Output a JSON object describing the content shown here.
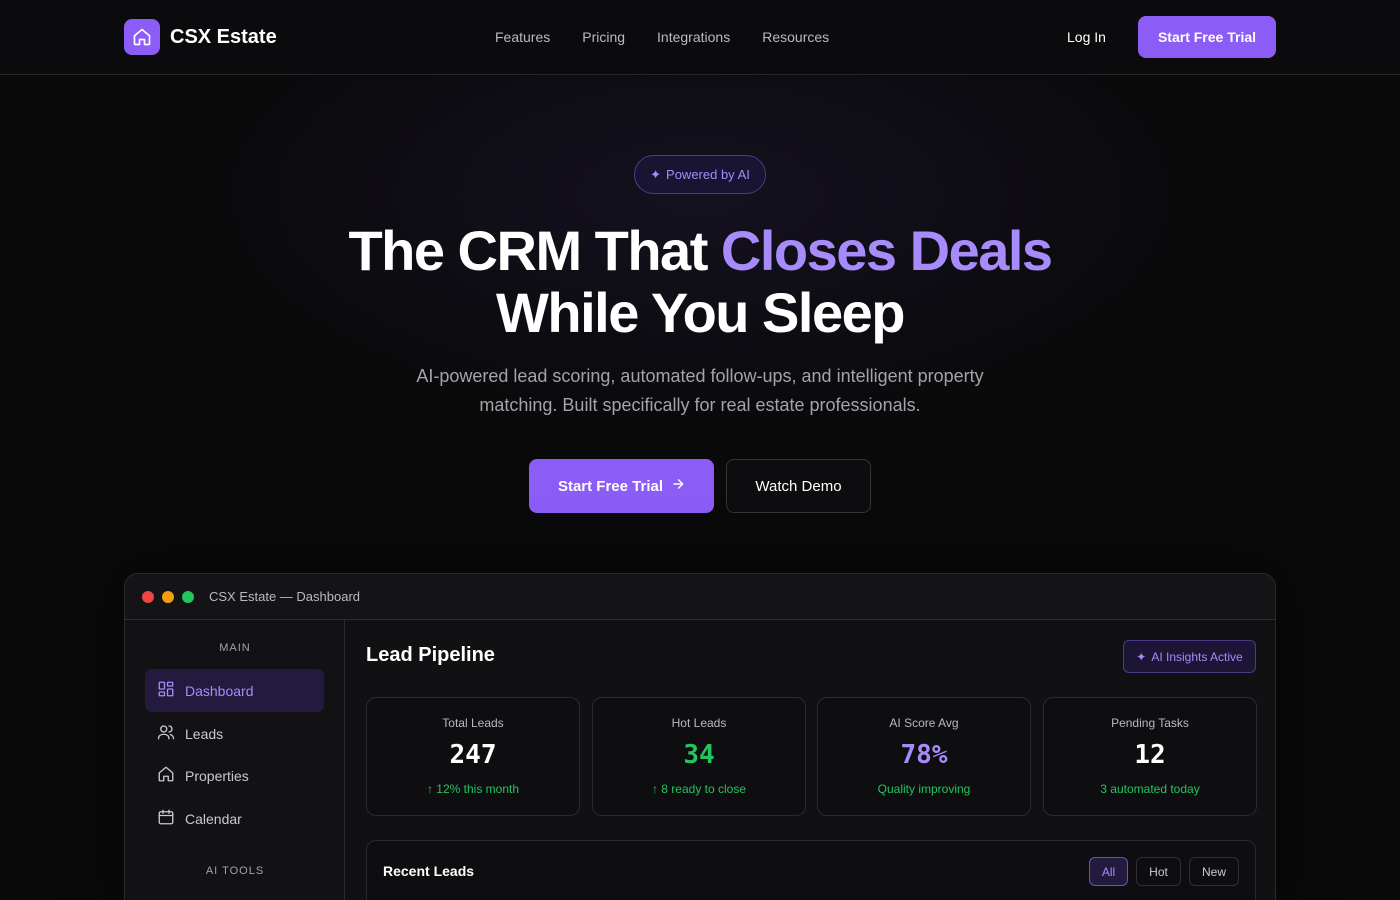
{
  "brand": {
    "name": "CSX Estate",
    "accent": "#8b5cf6",
    "logo_icon": "house-icon"
  },
  "nav": {
    "links": [
      "Features",
      "Pricing",
      "Integrations",
      "Resources"
    ],
    "login": "Log In",
    "cta": "Start Free Trial"
  },
  "hero": {
    "badge": "Powered by AI",
    "badge_icon": "sparkle-icon",
    "headline_part1": "The CRM That ",
    "headline_accent": "Closes Deals",
    "headline_line2": "While You Sleep",
    "subheading": "AI-powered lead scoring, automated follow-ups, and intelligent property matching. Built specifically for real estate professionals.",
    "primary_cta": "Start Free Trial",
    "secondary_cta": "Watch Demo"
  },
  "dashboard": {
    "window_title": "CSX Estate — Dashboard",
    "sidebar": {
      "main_heading": "MAIN",
      "items": [
        {
          "label": "Dashboard",
          "icon": "grid-icon",
          "active": true
        },
        {
          "label": "Leads",
          "icon": "users-icon",
          "active": false
        },
        {
          "label": "Properties",
          "icon": "house-icon",
          "active": false
        },
        {
          "label": "Calendar",
          "icon": "calendar-icon",
          "active": false
        }
      ],
      "ai_heading": "AI TOOLS"
    },
    "title": "Lead Pipeline",
    "ai_pill": "AI Insights Active",
    "stats": [
      {
        "label": "Total Leads",
        "value": "247",
        "note": "↑ 12% this month",
        "color": "#ffffff"
      },
      {
        "label": "Hot Leads",
        "value": "34",
        "note": "↑ 8 ready to close",
        "color": "#22c55e"
      },
      {
        "label": "AI Score Avg",
        "value": "78%",
        "note": "Quality improving",
        "color": "#a78bfa"
      },
      {
        "label": "Pending Tasks",
        "value": "12",
        "note": "3 automated today",
        "color": "#ffffff"
      }
    ],
    "recent": {
      "title": "Recent Leads",
      "filters": [
        "All",
        "Hot",
        "New"
      ],
      "active_filter": "All"
    }
  }
}
